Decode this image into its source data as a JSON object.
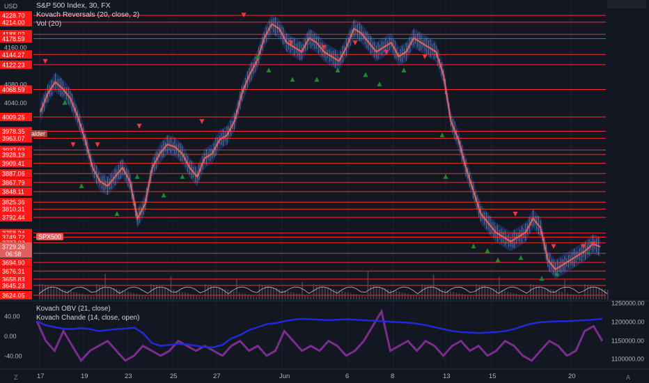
{
  "chart_title": "S&P 500 Index, 30, FX",
  "currency_label": "USD",
  "legend": [
    "Kovach Reversals (20, close, 2)",
    "Vol (20)"
  ],
  "indicator_legend": [
    "Kovach OBV (21, close)",
    "Kovach Chande (14, close, open)"
  ],
  "symbol_tag": "SPX500",
  "price_tag": "3729.26",
  "countdown_tag": "06:58",
  "partial_label": "alder",
  "price_levels": [
    "4228.70",
    "4214.00",
    "4188.02",
    "4178.59",
    "4144.27",
    "4122.23",
    "4068.59",
    "4009.25",
    "3978.35",
    "3963.07",
    "3937.93",
    "3928.19",
    "3909.41",
    "3887.06",
    "3867.79",
    "3848.11",
    "3825.36",
    "3810.31",
    "3792.44",
    "3758.34",
    "3749.72",
    "3737.32",
    "3714.72",
    "3694.90",
    "3676.31",
    "3658.83",
    "3645.23",
    "3624.05"
  ],
  "axis_ticks": [
    "4160.00",
    "4080.00",
    "4040.00"
  ],
  "osc_ticks": [
    "40.00",
    "0.00",
    "-40.00"
  ],
  "obv_ticks": [
    "1250000.00",
    "1200000.00",
    "1150000.00",
    "1100000.00"
  ],
  "date_labels": [
    "17",
    "19",
    "23",
    "25",
    "27",
    "Jun",
    "6",
    "8",
    "13",
    "15",
    "20"
  ],
  "bottom_left_btn": "Z",
  "bottom_right_btn": "A",
  "colors": {
    "background": "#131722",
    "grid": "#1f2330",
    "level_line": "#ff2a2a",
    "level_box": "#ff1a1a",
    "price_line": "#e0605d",
    "band": "#1e3a6e",
    "down_marker": "#f23645",
    "up_marker": "#1b8a2f",
    "obv": "#1f2bd8",
    "chande": "#7b2d8f"
  },
  "chart_data": {
    "type": "line",
    "title": "S&P 500 Index, 30, FX",
    "xlabel": "",
    "ylabel": "",
    "ylim": [
      3615,
      4250
    ],
    "x_ticks": [
      "17",
      "19",
      "23",
      "25",
      "27",
      "Jun",
      "6",
      "8",
      "13",
      "15",
      "20"
    ],
    "price": [
      4020,
      4060,
      4085,
      4070,
      4050,
      4010,
      3960,
      3900,
      3870,
      3860,
      3880,
      3900,
      3870,
      3790,
      3820,
      3900,
      3930,
      3950,
      3945,
      3930,
      3900,
      3880,
      3920,
      3930,
      3960,
      3970,
      4000,
      4060,
      4100,
      4130,
      4180,
      4210,
      4200,
      4170,
      4160,
      4150,
      4180,
      4170,
      4150,
      4140,
      4130,
      4160,
      4200,
      4190,
      4170,
      4150,
      4160,
      4170,
      4140,
      4150,
      4180,
      4170,
      4160,
      4150,
      4100,
      4000,
      3960,
      3900,
      3850,
      3800,
      3780,
      3760,
      3750,
      3740,
      3750,
      3760,
      3790,
      3770,
      3700,
      3680,
      3690,
      3700,
      3710,
      3720,
      3735,
      3729
    ],
    "up_markers": [
      [
        93,
        4040
      ],
      [
        117,
        3860
      ],
      [
        168,
        3800
      ],
      [
        197,
        3880
      ],
      [
        235,
        3840
      ],
      [
        262,
        3880
      ],
      [
        370,
        4140
      ],
      [
        386,
        4110
      ],
      [
        420,
        4090
      ],
      [
        455,
        4090
      ],
      [
        485,
        4110
      ],
      [
        525,
        4100
      ],
      [
        545,
        4080
      ],
      [
        580,
        4110
      ],
      [
        635,
        3970
      ],
      [
        640,
        3880
      ],
      [
        680,
        3730
      ],
      [
        700,
        3720
      ],
      [
        715,
        3700
      ],
      [
        748,
        3705
      ],
      [
        778,
        3660
      ],
      [
        800,
        3670
      ]
    ],
    "down_markers": [
      [
        65,
        4130
      ],
      [
        105,
        3950
      ],
      [
        140,
        3950
      ],
      [
        200,
        3990
      ],
      [
        290,
        4000
      ],
      [
        350,
        4230
      ],
      [
        418,
        4170
      ],
      [
        465,
        4160
      ],
      [
        510,
        4170
      ],
      [
        555,
        4150
      ],
      [
        610,
        4140
      ],
      [
        740,
        3800
      ],
      [
        795,
        3730
      ],
      [
        838,
        3730
      ],
      [
        852,
        3735
      ]
    ],
    "obv": [
      30,
      22,
      18,
      15,
      14,
      16,
      14,
      10,
      12,
      14,
      15,
      17,
      6,
      -14,
      -20,
      -18,
      -16,
      -17,
      -20,
      -22,
      -23,
      -18,
      -5,
      2,
      12,
      18,
      24,
      26,
      30,
      33,
      35,
      34,
      33,
      32,
      33,
      34,
      33,
      32,
      31,
      30,
      29,
      28,
      27,
      25,
      22,
      18,
      14,
      10,
      8,
      7,
      6,
      7,
      8,
      10,
      14,
      20,
      25,
      28,
      29,
      30,
      30,
      31,
      32,
      33,
      35
    ],
    "chande": [
      30,
      -10,
      -30,
      10,
      -20,
      -50,
      -30,
      -20,
      -10,
      -30,
      -50,
      -40,
      -20,
      -30,
      -40,
      -30,
      -10,
      -20,
      -30,
      -20,
      -30,
      -40,
      -20,
      -10,
      -30,
      -20,
      -40,
      -30,
      10,
      -10,
      -30,
      -20,
      -30,
      -10,
      -20,
      -40,
      -30,
      -10,
      20,
      50,
      -30,
      -20,
      -10,
      -30,
      -10,
      -20,
      -40,
      -20,
      -10,
      -30,
      -20,
      -40,
      -30,
      -10,
      -20,
      -40,
      -50,
      -30,
      -10,
      -20,
      -40,
      -30,
      10,
      20,
      -10
    ]
  }
}
